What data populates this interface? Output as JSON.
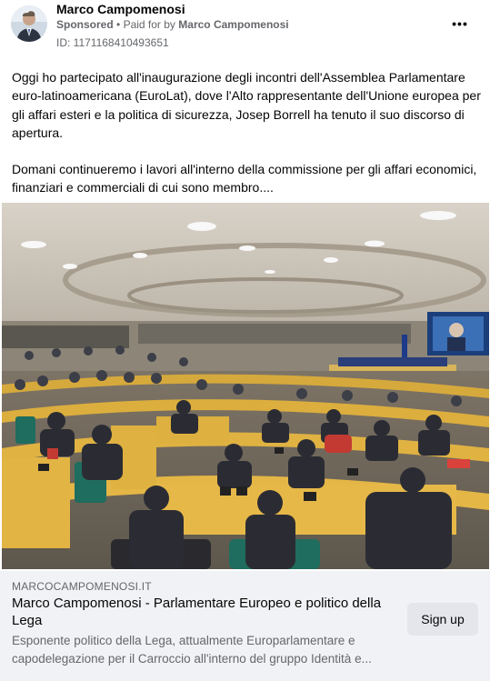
{
  "post": {
    "author": "Marco Campomenosi",
    "sponsored_label": "Sponsored",
    "separator": "•",
    "paid_for_by_prefix": "Paid for by",
    "paid_for_by_name": "Marco Campomenosi",
    "ad_id": "ID: 1171168410493651",
    "more_options_icon": "ellipsis-icon",
    "paragraph_1": "Oggi ho partecipato all'inaugurazione degli incontri dell'Assemblea Parlamentare euro-latinoamericana (EuroLat), dove l'Alto rappresentante dell'Unione europea per gli affari esteri e la politica di sicurezza, Josep Borrell ha tenuto il suo discorso di apertura.",
    "paragraph_2": "Domani continueremo i lavori all'interno della commissione per gli affari economici, finanziari e commerciali di cui sono membro...."
  },
  "link_preview": {
    "domain": "MARCOCAMPOMENOSI.IT",
    "title": "Marco Campomenosi - Parlamentare Europeo e politico della Lega",
    "description": "Esponente politico della Lega, attualmente Europarlamentare e capodelegazione per il Carroccio all'interno del gruppo Identità e...",
    "cta_label": "Sign up"
  },
  "colors": {
    "text_primary": "#050505",
    "text_secondary": "#65676b",
    "footer_bg": "#f0f2f5",
    "button_bg": "#e4e6eb"
  }
}
